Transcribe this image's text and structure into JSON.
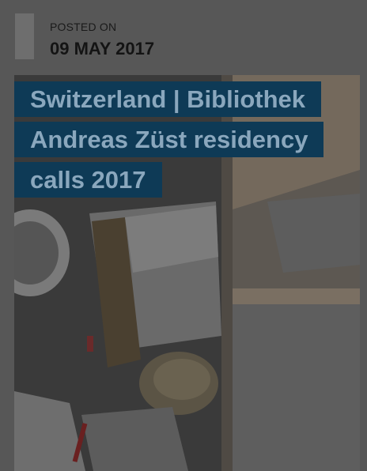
{
  "post": {
    "posted_label": "POSTED ON",
    "date": "09 MAY 2017",
    "title": "Switzerland | Bibliothek Andreas Züst residency calls 2017"
  },
  "image": {
    "subject": "books-photo"
  }
}
